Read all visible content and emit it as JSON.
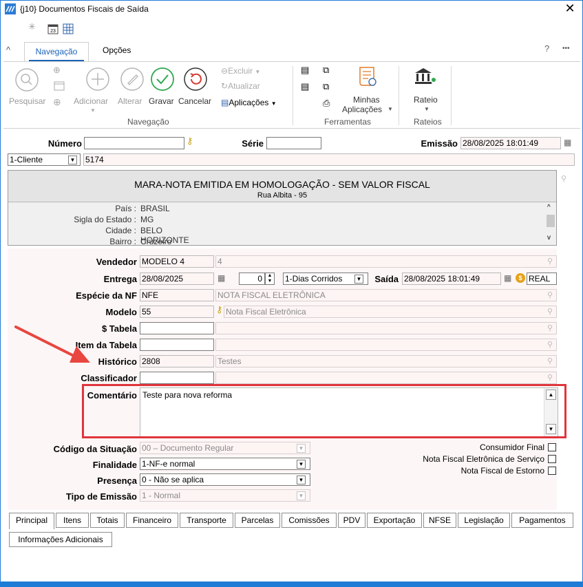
{
  "window": {
    "title": "{j10}  Documentos Fiscais de Saída",
    "close": "✕"
  },
  "ribbon": {
    "tabs": [
      "Navegação",
      "Opções"
    ],
    "help": "?",
    "more": "•••",
    "buttons": {
      "pesquisar": "Pesquisar",
      "adicionar": "Adicionar",
      "alterar": "Alterar",
      "gravar": "Gravar",
      "cancelar": "Cancelar",
      "excluir": "Excluir",
      "atualizar": "Atualizar",
      "aplicacoes": "Aplicações",
      "minhas_aplicacoes_1": "Minhas",
      "minhas_aplicacoes_2": "Aplicações",
      "rateio": "Rateio"
    },
    "groups": {
      "navegacao": "Navegação",
      "ferramentas": "Ferramentas",
      "rateios": "Rateios"
    }
  },
  "header": {
    "numero_label": "Número",
    "numero_value": "",
    "serie_label": "Série",
    "serie_value": "",
    "emissao_label": "Emissão",
    "emissao_value": "28/08/2025 18:01:49",
    "cliente_type": "1-Cliente",
    "cliente_code": "5174"
  },
  "client_panel": {
    "name": "MARA-NOTA EMITIDA EM HOMOLOGAÇÃO - SEM VALOR FISCAL",
    "address": "Rua Albita - 95",
    "info": [
      {
        "label": "País",
        "value": "BRASIL"
      },
      {
        "label": "Sigla do Estado",
        "value": "MG"
      },
      {
        "label": "Cidade",
        "value": "BELO HORIZONTE"
      },
      {
        "label": "Bairro",
        "value": "Cruzeiro"
      }
    ]
  },
  "fields": {
    "vendedor": {
      "label": "Vendedor",
      "code": "MODELO 4",
      "desc": "4"
    },
    "entrega": {
      "label": "Entrega",
      "date": "28/08/2025",
      "days": "0",
      "prazo": "1-Dias Corridos"
    },
    "saida": {
      "label": "Saída",
      "value": "28/08/2025 18:01:49",
      "moeda": "REAL"
    },
    "especie": {
      "label": "Espécie da NF",
      "code": "NFE",
      "desc": "NOTA FISCAL ELETRÔNICA"
    },
    "modelo": {
      "label": "Modelo",
      "code": "55",
      "desc": "Nota Fiscal Eletrônica"
    },
    "tabela": {
      "label": "$ Tabela",
      "code": "",
      "desc": ""
    },
    "item_tabela": {
      "label": "Item da Tabela",
      "code": "",
      "desc": ""
    },
    "historico": {
      "label": "Histórico",
      "code": "2808",
      "desc": "Testes"
    },
    "classificador": {
      "label": "Classificador",
      "code": "",
      "desc": ""
    },
    "comentario": {
      "label": "Comentário",
      "value": "Teste para nova reforma"
    },
    "codigo_situacao": {
      "label": "Código da Situação",
      "value": "00 – Documento Regular"
    },
    "finalidade": {
      "label": "Finalidade",
      "value": "1-NF-e normal"
    },
    "presenca": {
      "label": "Presença",
      "value": "0 - Não se aplica"
    },
    "tipo_emissao": {
      "label": "Tipo de Emissão",
      "value": "1 - Normal"
    }
  },
  "checkboxes": [
    {
      "label": "Consumidor Final",
      "checked": false
    },
    {
      "label": "Nota Fiscal Eletrônica de Serviço",
      "checked": false
    },
    {
      "label": "Nota Fiscal de Estorno",
      "checked": false
    }
  ],
  "bottom_tabs": [
    "Principal",
    "Itens",
    "Totais",
    "Financeiro",
    "Transporte",
    "Parcelas",
    "Comissões",
    "PDV",
    "Exportação",
    "NFSE",
    "Legislação",
    "Pagamentos",
    "Informações Adicionais"
  ],
  "colors": {
    "accent": "#1a62b8",
    "highlight_box": "#e0343c",
    "arrow": "#e8463f",
    "gravar_green": "#2fa84f",
    "cancelar_red": "#d73a33"
  }
}
